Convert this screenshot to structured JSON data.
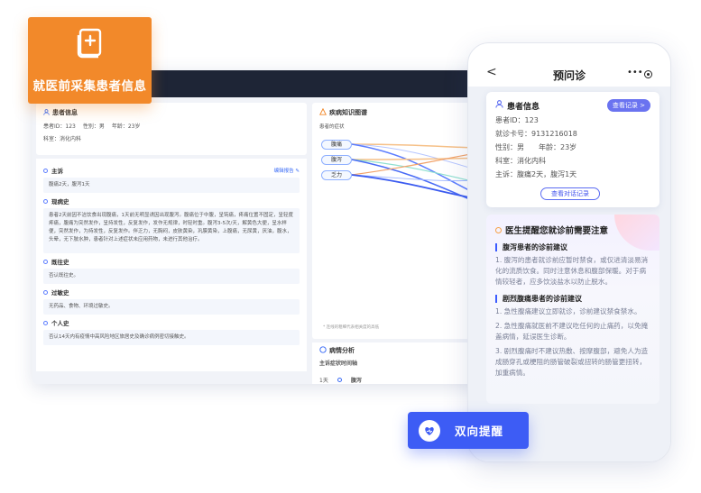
{
  "badge": {
    "label": "就医前采集患者信息"
  },
  "desktop": {
    "patient": {
      "title": "患者信息",
      "id_line": "患者ID：123",
      "gender": "性别：男",
      "age": "年龄：23岁",
      "dept": "科室：消化内科"
    },
    "sections": [
      {
        "title": "主诉",
        "content": "腹痛2天，腹泻1天",
        "edit": "编辑报告"
      },
      {
        "title": "现病史",
        "content": "患者2天前因不洁饮食出现腹痛，1天前无明显诱因出现腹泻。腹痛位于中腹，呈钝痛，疼痛位置不固定，呈轻度疼痛，腹痛为突然发作，呈持发性，反复发作，发作无规律，时轻时重。腹泻3-5次/天，解黄色大便，呈水样便，突然发作，为持发性，反复发作。伴乏力，无胸闷，皮肤黄染，巩膜黄染，上腹痛，无尿黄，厌油，腹水，头晕，无下肢水肿，患者针对上述症状未应用药物，未进行其他治疗。"
      },
      {
        "title": "既往史",
        "content": "否认既往史。"
      },
      {
        "title": "过敏史",
        "content": "无药品、食物、环境过敏史。"
      },
      {
        "title": "个人史",
        "content": "否认14天内有疫情中高风险地区旅居史及确诊病例密切接触史。"
      }
    ],
    "graph": {
      "title": "疾病知识图谱",
      "sub": "患者的症状",
      "symptoms": [
        "腹痛",
        "腹泻",
        "乏力"
      ],
      "note": "* 连线的粗细代表相关度的高低"
    },
    "analysis": {
      "title": "病情分析",
      "sub": "主诉症状时间轴",
      "time": "1天",
      "item": "腹泻"
    }
  },
  "phone": {
    "nav": {
      "title": "预问诊",
      "back": "<",
      "more": "•••"
    },
    "card": {
      "title": "患者信息",
      "pill": "查看记录 >",
      "lines": [
        "患者ID：123",
        "就诊卡号：9131216018"
      ],
      "gender": "性别：男",
      "age": "年龄：23岁",
      "dept": "科室：消化内科",
      "complaint": "主诉：腹痛2天，腹泻1天",
      "button": "查看对话记录"
    },
    "reminder": {
      "title": "医生提醒您就诊前需要注意",
      "groups": [
        {
          "head": "腹泻患者的诊前建议",
          "items": [
            "1. 腹泻的患者就诊前应暂时禁食，或仅进清淡易消化的流质饮食。同时注意休息和腹部保暖。对于病情较轻者，应多饮淡盐水以防止脱水。"
          ]
        },
        {
          "head": "剧烈腹痛患者的诊前建议",
          "items": [
            "1. 急性腹痛建议立即就诊，诊前建议禁食禁水。",
            "2. 急性腹痛就医前不建议吃任何的止痛药，以免掩盖病情，延误医生诊断。",
            "3. 剧烈腹痛时不建议热敷、按摩腹部，避免人为造成肠穿孔或梗阻的肠管破裂或扭转的肠管更扭转，加重病情。"
          ]
        }
      ]
    }
  },
  "dual_button": {
    "label": "双向提醒"
  },
  "colors": {
    "orange": "#f2892a",
    "blue": "#3d5cf5",
    "nav_dark": "#1e2536",
    "purple_pill": "#6a73f0"
  }
}
